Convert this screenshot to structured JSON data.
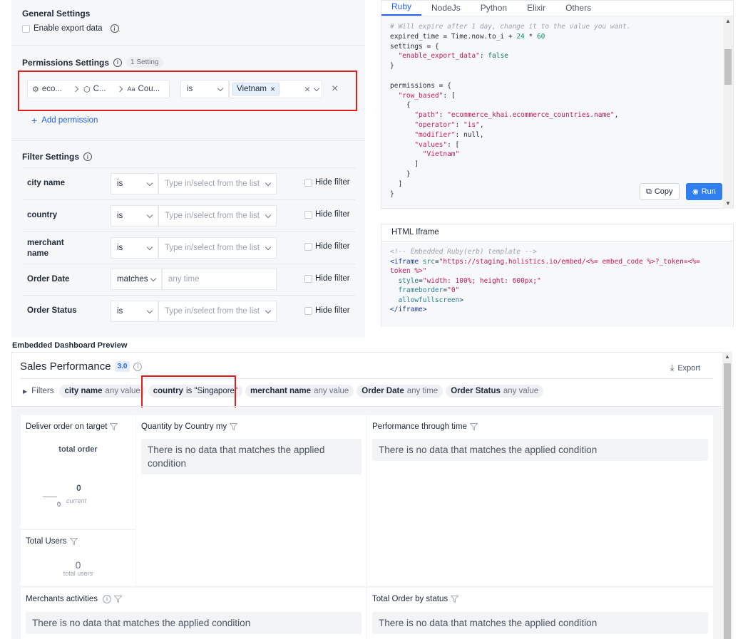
{
  "general_settings": {
    "title": "General Settings",
    "enable_export_label": "Enable export data"
  },
  "permissions_settings": {
    "title": "Permissions Settings",
    "badge": "1 Setting",
    "path_parts": [
      "eco...",
      "C...",
      "Cou..."
    ],
    "operator": "is",
    "value_tag": "Vietnam",
    "add_permission_label": "Add permission"
  },
  "filter_settings": {
    "title": "Filter Settings",
    "hide_filter_label": "Hide filter",
    "rows": [
      {
        "label": "city name",
        "operator": "is",
        "placeholder": "Type in/select from the list"
      },
      {
        "label": "country",
        "operator": "is",
        "placeholder": "Type in/select from the list"
      },
      {
        "label": "merchant name",
        "operator": "is",
        "placeholder": "Type in/select from the list"
      },
      {
        "label": "Order Date",
        "operator": "matches",
        "placeholder": "any time"
      },
      {
        "label": "Order Status",
        "operator": "is",
        "placeholder": "Type in/select from the list"
      }
    ]
  },
  "code_panel": {
    "tabs": [
      "Ruby",
      "NodeJs",
      "Python",
      "Elixir",
      "Others"
    ],
    "active_tab": "Ruby",
    "copy_label": "Copy",
    "run_label": "Run"
  },
  "iframe_panel": {
    "title": "HTML Iframe"
  },
  "dashboard": {
    "preview_label": "Embedded Dashboard Preview",
    "title": "Sales Performance",
    "version": "3.0",
    "export_label": "Export",
    "filters_label": "Filters",
    "filter_chips": [
      {
        "name": "city name",
        "value": "any value"
      },
      {
        "name": "country",
        "value": "is \"Singapore\""
      },
      {
        "name": "merchant name",
        "value": "any value"
      },
      {
        "name": "Order Date",
        "value": "any time"
      },
      {
        "name": "Order Status",
        "value": "any value"
      }
    ],
    "no_data_text": "There is no data that matches the applied condition",
    "widgets": {
      "deliver": {
        "title": "Deliver order on target",
        "metric": "total order",
        "value": "0",
        "axis_zero": "0",
        "sub": "current"
      },
      "quantity": {
        "title": "Quantity by Country my"
      },
      "performance": {
        "title": "Performance through time"
      },
      "total_users": {
        "title": "Total Users",
        "value": "0",
        "sub": "total users"
      },
      "merchants": {
        "title": "Merchants activities"
      },
      "total_order": {
        "title": "Total Order by status"
      }
    }
  },
  "colors": {
    "accent": "#2563eb",
    "highlight_border": "#e31b1b",
    "run_button": "#2f7ff0"
  }
}
